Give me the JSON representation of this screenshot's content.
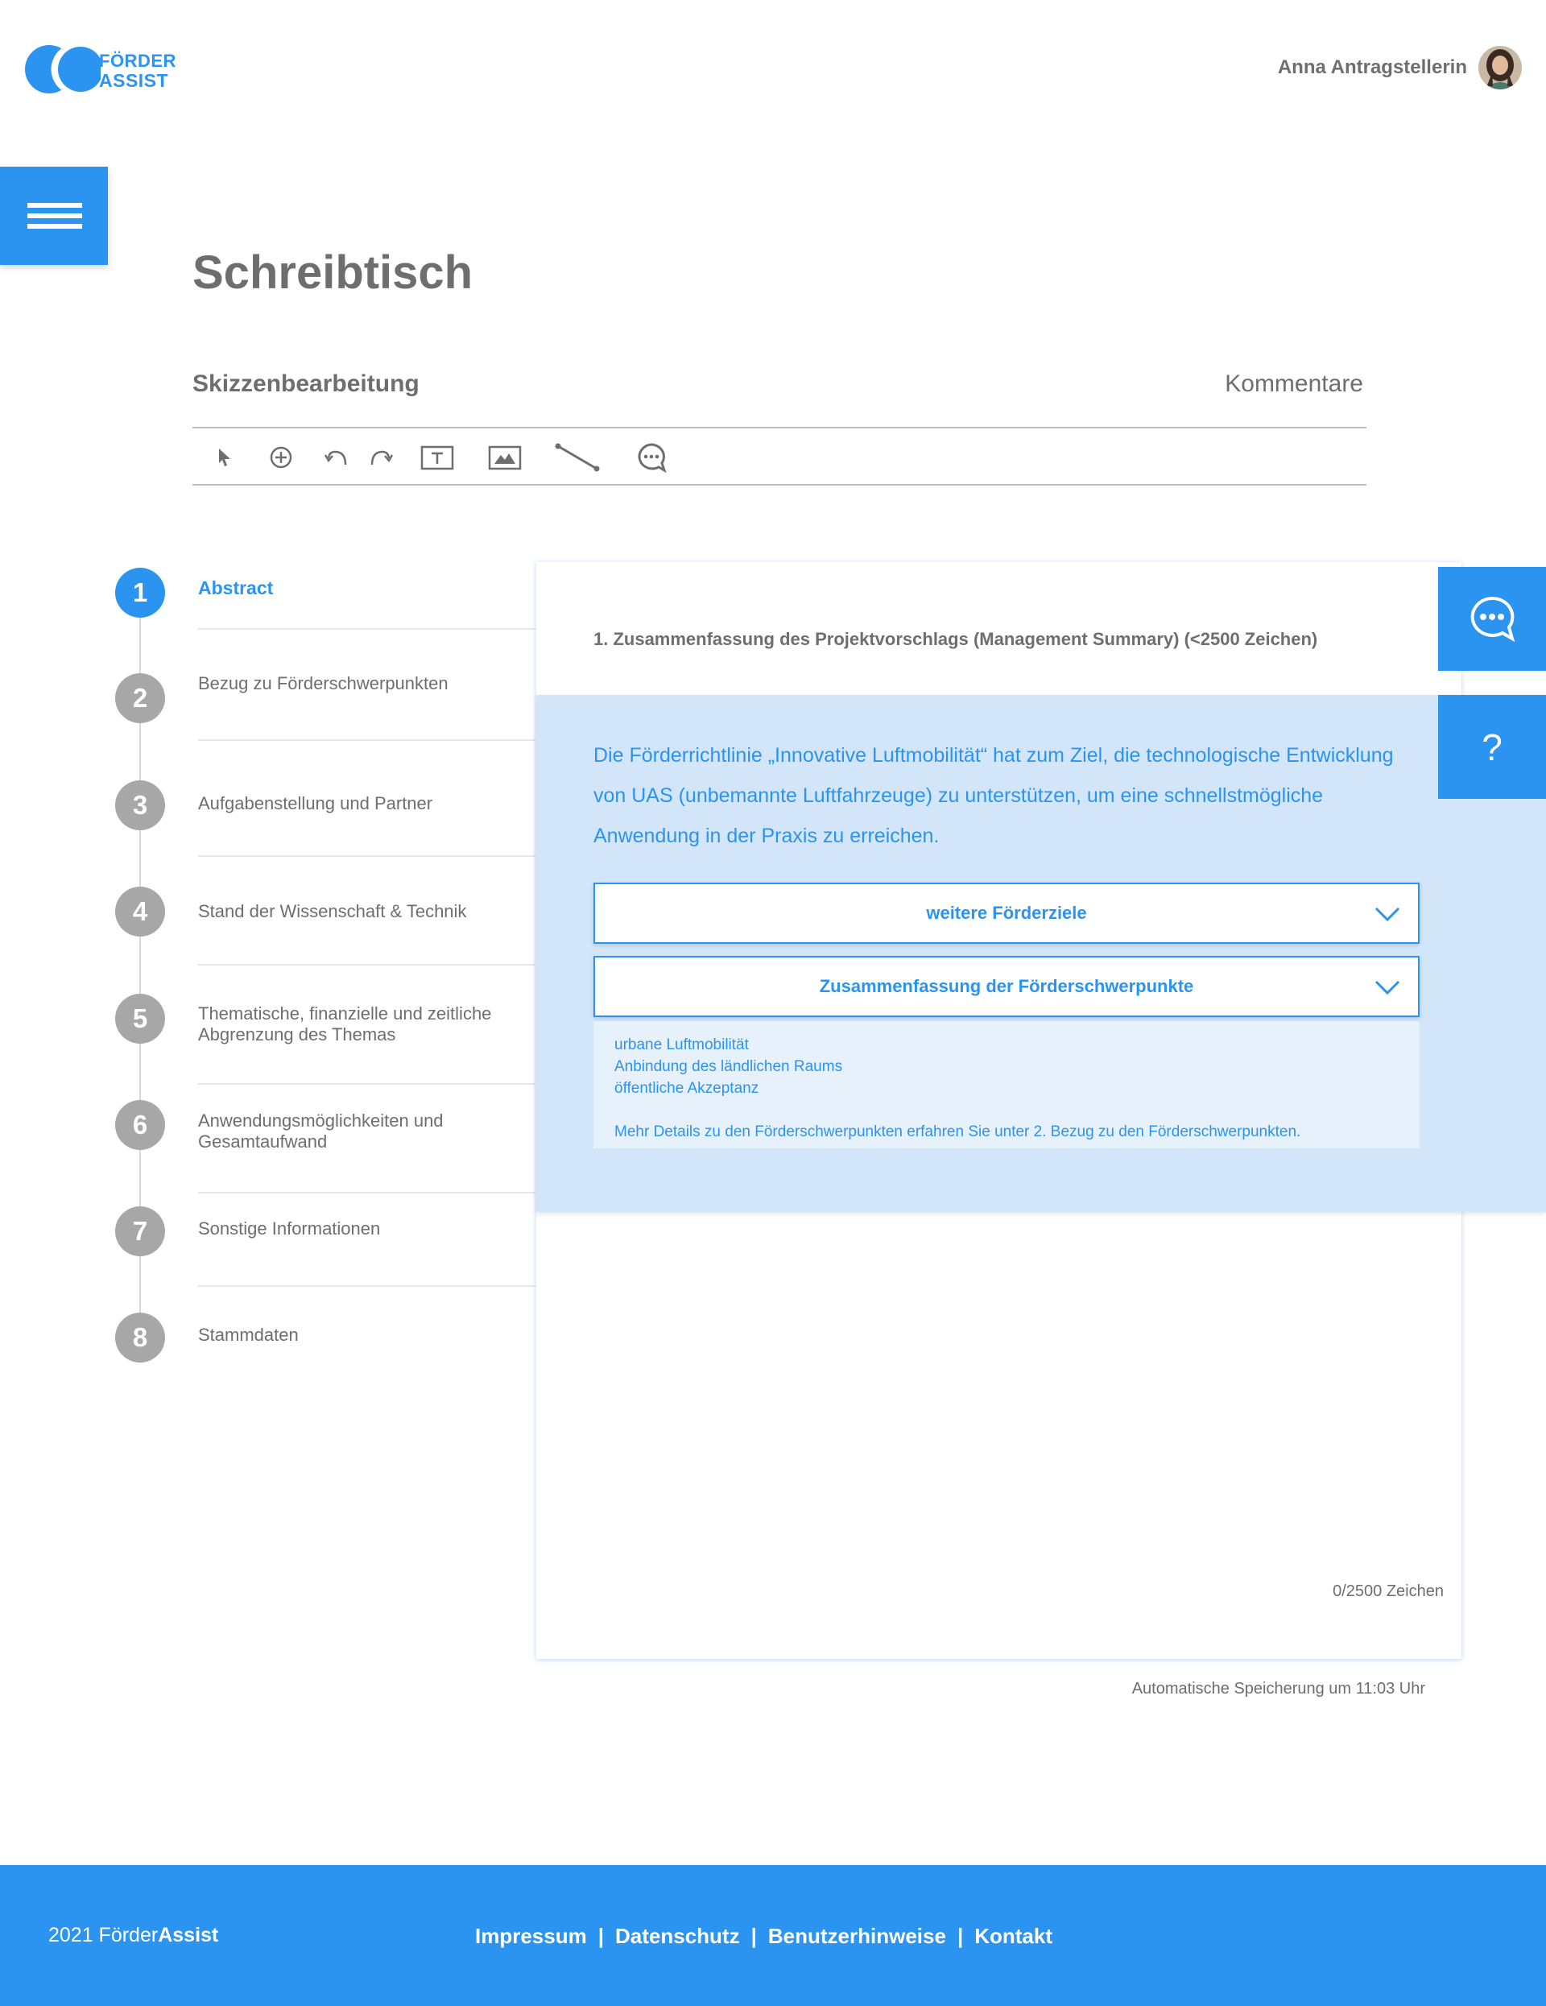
{
  "brand": {
    "line1": "FÖRDER",
    "line2": "ASSIST",
    "color": "#2b93f0"
  },
  "user": {
    "name": "Anna Antragstellerin",
    "avatar_icon": "user-avatar"
  },
  "page": {
    "title": "Schreibtisch"
  },
  "editor": {
    "title": "Skizzenbearbeitung",
    "comments_label": "Kommentare",
    "tools": [
      "pointer-icon",
      "add-icon",
      "undo-icon",
      "redo-icon",
      "text-tool-icon",
      "image-tool-icon",
      "line-tool-icon",
      "comment-tool-icon"
    ]
  },
  "steps": [
    {
      "num": "1",
      "label": "Abstract"
    },
    {
      "num": "2",
      "label": "Bezug zu Förderschwerpunkten"
    },
    {
      "num": "3",
      "label": "Aufgabenstellung und Partner"
    },
    {
      "num": "4",
      "label": "Stand der Wissenschaft & Technik"
    },
    {
      "num": "5",
      "label": "Thematische, finanzielle und zeitliche Abgrenzung des Themas"
    },
    {
      "num": "6",
      "label": "Anwendungsmöglichkeiten und Gesamtaufwand"
    },
    {
      "num": "7",
      "label": "Sonstige Informationen"
    },
    {
      "num": "8",
      "label": "Stammdaten"
    }
  ],
  "card": {
    "question": "1. Zusammenfassung des Projektvorschlags (Management Summary) (<2500 Zeichen)",
    "counter": "0/2500 Zeichen"
  },
  "info": {
    "text": "Die Förderrichtlinie „Innovative Luftmobilität“ hat zum Ziel, die technologische Entwicklung von UAS (unbemannte Luftfahrzeuge) zu unterstützen, um eine schnellstmögliche Anwendung in der Praxis zu erreichen.",
    "accordion1": "weitere Förderziele",
    "accordion2": "Zusammenfassung der Förderschwerpunkte",
    "items": [
      "urbane Luftmobilität",
      "Anbindung des ländlichen Raums",
      "öffentliche Akzeptanz"
    ],
    "more": "Mehr Details zu den Förderschwerpunkten erfahren Sie unter 2. Bezug zu den Förderschwerpunkten."
  },
  "side": {
    "help_label": "?"
  },
  "autosave": "Automatische Speicherung um 11:03 Uhr",
  "footer": {
    "year": "2021 Förder",
    "brand_bold": "Assist",
    "links": [
      "Impressum",
      "Datenschutz",
      "Benutzerhinweise",
      "Kontakt"
    ],
    "sep": "|"
  }
}
